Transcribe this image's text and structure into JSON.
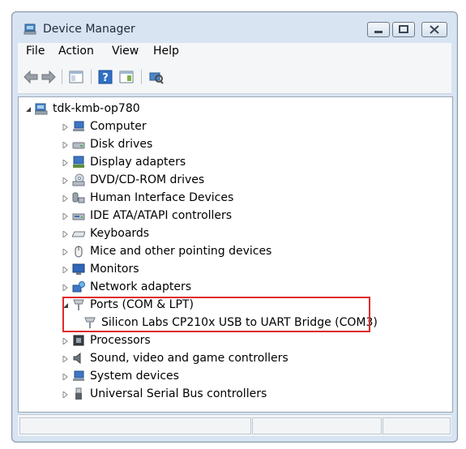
{
  "window": {
    "title": "Device Manager"
  },
  "menu": [
    "File",
    "Action",
    "View",
    "Help"
  ],
  "toolbar_icons": [
    "back-icon",
    "forward-icon",
    "show-hide-console-tree-icon",
    "help-icon",
    "properties-icon",
    "scan-hardware-icon"
  ],
  "tree": {
    "root": {
      "label": "tdk-kmb-op780",
      "icon": "computer-icon",
      "expanded": true
    },
    "items": [
      {
        "label": "Computer",
        "icon": "computer-icon",
        "expanded": false
      },
      {
        "label": "Disk drives",
        "icon": "disk-drive-icon",
        "expanded": false
      },
      {
        "label": "Display adapters",
        "icon": "display-adapter-icon",
        "expanded": false
      },
      {
        "label": "DVD/CD-ROM drives",
        "icon": "dvd-drive-icon",
        "expanded": false
      },
      {
        "label": "Human Interface Devices",
        "icon": "hid-icon",
        "expanded": false
      },
      {
        "label": "IDE ATA/ATAPI controllers",
        "icon": "ide-controller-icon",
        "expanded": false
      },
      {
        "label": "Keyboards",
        "icon": "keyboard-icon",
        "expanded": false
      },
      {
        "label": "Mice and other pointing devices",
        "icon": "mouse-icon",
        "expanded": false
      },
      {
        "label": "Monitors",
        "icon": "monitor-icon",
        "expanded": false
      },
      {
        "label": "Network adapters",
        "icon": "network-adapter-icon",
        "expanded": false
      },
      {
        "label": "Ports (COM & LPT)",
        "icon": "port-icon",
        "expanded": true,
        "children": [
          {
            "label": "Silicon Labs CP210x USB to UART Bridge (COM3)",
            "icon": "port-icon"
          }
        ]
      },
      {
        "label": "Processors",
        "icon": "processor-icon",
        "expanded": false
      },
      {
        "label": "Sound, video and game controllers",
        "icon": "sound-icon",
        "expanded": false
      },
      {
        "label": "System devices",
        "icon": "system-device-icon",
        "expanded": false
      },
      {
        "label": "Universal Serial Bus controllers",
        "icon": "usb-icon",
        "expanded": false
      }
    ]
  },
  "highlight": {
    "color": "#e02b2b"
  }
}
